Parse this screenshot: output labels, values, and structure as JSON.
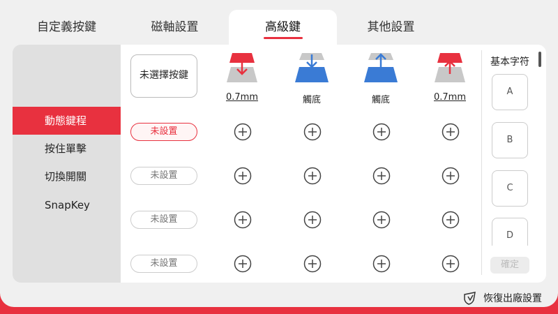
{
  "tabs": [
    {
      "label": "自定義按鍵"
    },
    {
      "label": "磁軸設置"
    },
    {
      "label": "高級鍵"
    },
    {
      "label": "其他設置"
    }
  ],
  "sidebar": {
    "items": [
      {
        "label": "動態鍵程"
      },
      {
        "label": "按住單擊"
      },
      {
        "label": "切換開關"
      },
      {
        "label": "SnapKey"
      }
    ]
  },
  "main": {
    "select_key_label": "未選擇按鍵",
    "columns": [
      {
        "label": "0.7mm",
        "icon": "key-press-down-red-icon",
        "color": "#e8313f"
      },
      {
        "label": "觸底",
        "icon": "key-bottom-down-blue-icon",
        "color": "#3a7bd5"
      },
      {
        "label": "觸底",
        "icon": "key-bottom-up-blue-icon",
        "color": "#3a7bd5"
      },
      {
        "label": "0.7mm",
        "icon": "key-release-up-red-icon",
        "color": "#e8313f"
      }
    ],
    "rows": [
      {
        "label": "未設置"
      },
      {
        "label": "未設置"
      },
      {
        "label": "未設置"
      },
      {
        "label": "未設置"
      }
    ]
  },
  "chars": {
    "title": "基本字符",
    "items": [
      "A",
      "B",
      "C",
      "D"
    ],
    "confirm_label": "確定"
  },
  "footer": {
    "reset_label": "恢復出廠設置"
  },
  "colors": {
    "accent": "#e8313f",
    "blue": "#3a7bd5"
  }
}
